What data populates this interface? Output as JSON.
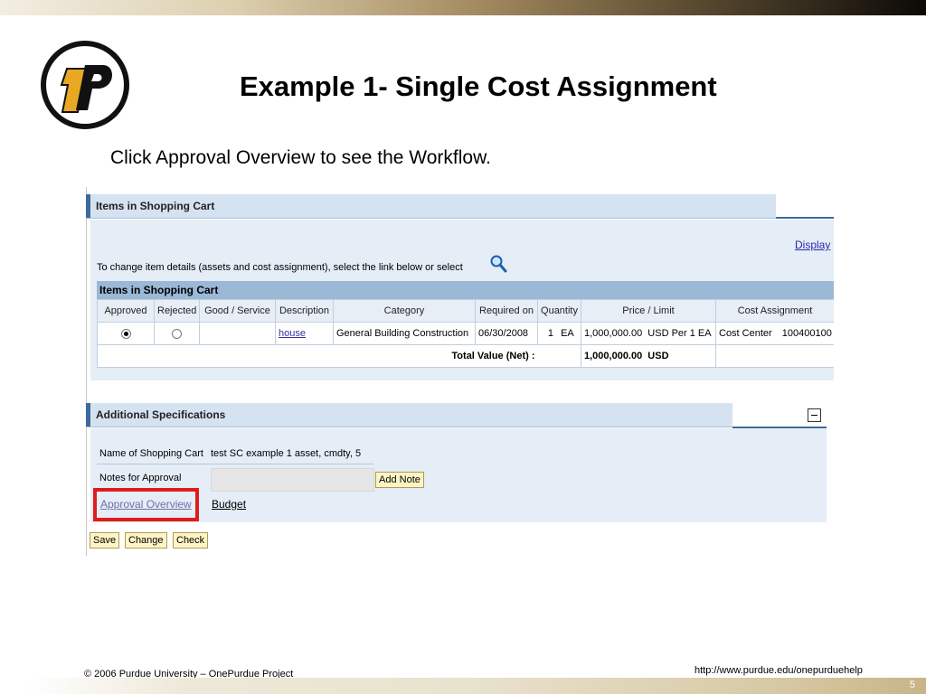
{
  "slide": {
    "title": "Example 1- Single Cost Assignment",
    "instruction": "Click Approval Overview to see the Workflow.",
    "footer_left": "© 2006 Purdue University – OnePurdue Project",
    "footer_right": "http://www.purdue.edu/onepurduehelp",
    "page_number": "5",
    "logo_icon": "onepurdue-logo-icon"
  },
  "cart": {
    "header": "Items in Shopping Cart",
    "display_link": "Display",
    "change_text": "To change item details (assets and cost assignment), select the link below or select",
    "magnifier_icon": "magnifier-icon",
    "table_title": "Items in Shopping Cart",
    "columns": [
      "Approved",
      "Rejected",
      "Good / Service",
      "Description",
      "Category",
      "Required on",
      "Quantity",
      "Price / Limit",
      "Cost Assignment"
    ],
    "row": {
      "approved_selected": true,
      "rejected_selected": false,
      "good_service": "",
      "description": "house",
      "category": "General Building Construction",
      "required_on": "06/30/2008",
      "quantity": "1",
      "unit": "EA",
      "price": "1,000,000.00",
      "price_unit": "USD Per 1 EA",
      "cost_assignment_type": "Cost Center",
      "cost_assignment_value": "100400100"
    },
    "total_label": "Total Value (Net)  :",
    "total_value": "1,000,000.00",
    "total_currency": "USD"
  },
  "additional": {
    "header": "Additional Specifications",
    "collapse_icon": "minus-icon",
    "name_label": "Name of Shopping Cart",
    "name_value": "test SC example 1 asset, cmdty, 5",
    "notes_label": "Notes for Approval",
    "notes_value": "",
    "add_note_button": "Add Note",
    "approval_overview_link": "Approval Overview",
    "budget_link": "Budget"
  },
  "actions": {
    "save": "Save",
    "change": "Change",
    "check": "Check"
  },
  "colors": {
    "tray_header": "#d5e2f1",
    "tray_body": "#e5edf6",
    "table_title_bar": "#9bb8d6",
    "highlight": "#e01b1b",
    "button_fill": "#fef5c6",
    "logo_gold": "#e8a823"
  }
}
